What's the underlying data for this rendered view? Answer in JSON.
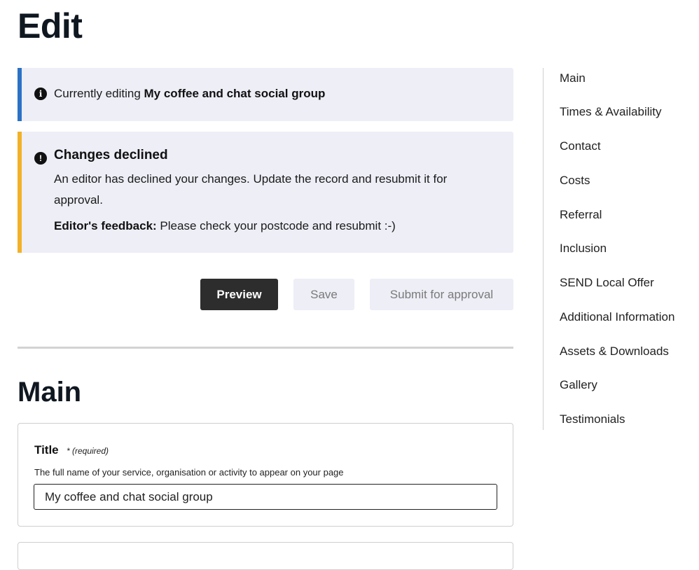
{
  "page": {
    "title": "Edit"
  },
  "info_alert": {
    "prefix": "Currently editing ",
    "record_name": "My coffee and chat social group"
  },
  "warning_alert": {
    "heading": "Changes declined",
    "body": "An editor has declined your changes. Update the record and resubmit it for approval.",
    "feedback_label": "Editor's feedback:",
    "feedback_text": " Please check your postcode and resubmit :-)"
  },
  "actions": {
    "preview_label": "Preview",
    "save_label": "Save",
    "submit_label": "Submit for approval"
  },
  "section": {
    "title": "Main"
  },
  "title_field": {
    "label": "Title",
    "required_note": "* (required)",
    "hint": "The full name of your service, organisation or activity to appear on your page",
    "value": "My coffee and chat social group"
  },
  "sidenav": {
    "items": [
      "Main",
      "Times & Availability",
      "Contact",
      "Costs",
      "Referral",
      "Inclusion",
      "SEND Local Offer",
      "Additional Information",
      "Assets & Downloads",
      "Gallery",
      "Testimonials"
    ]
  }
}
